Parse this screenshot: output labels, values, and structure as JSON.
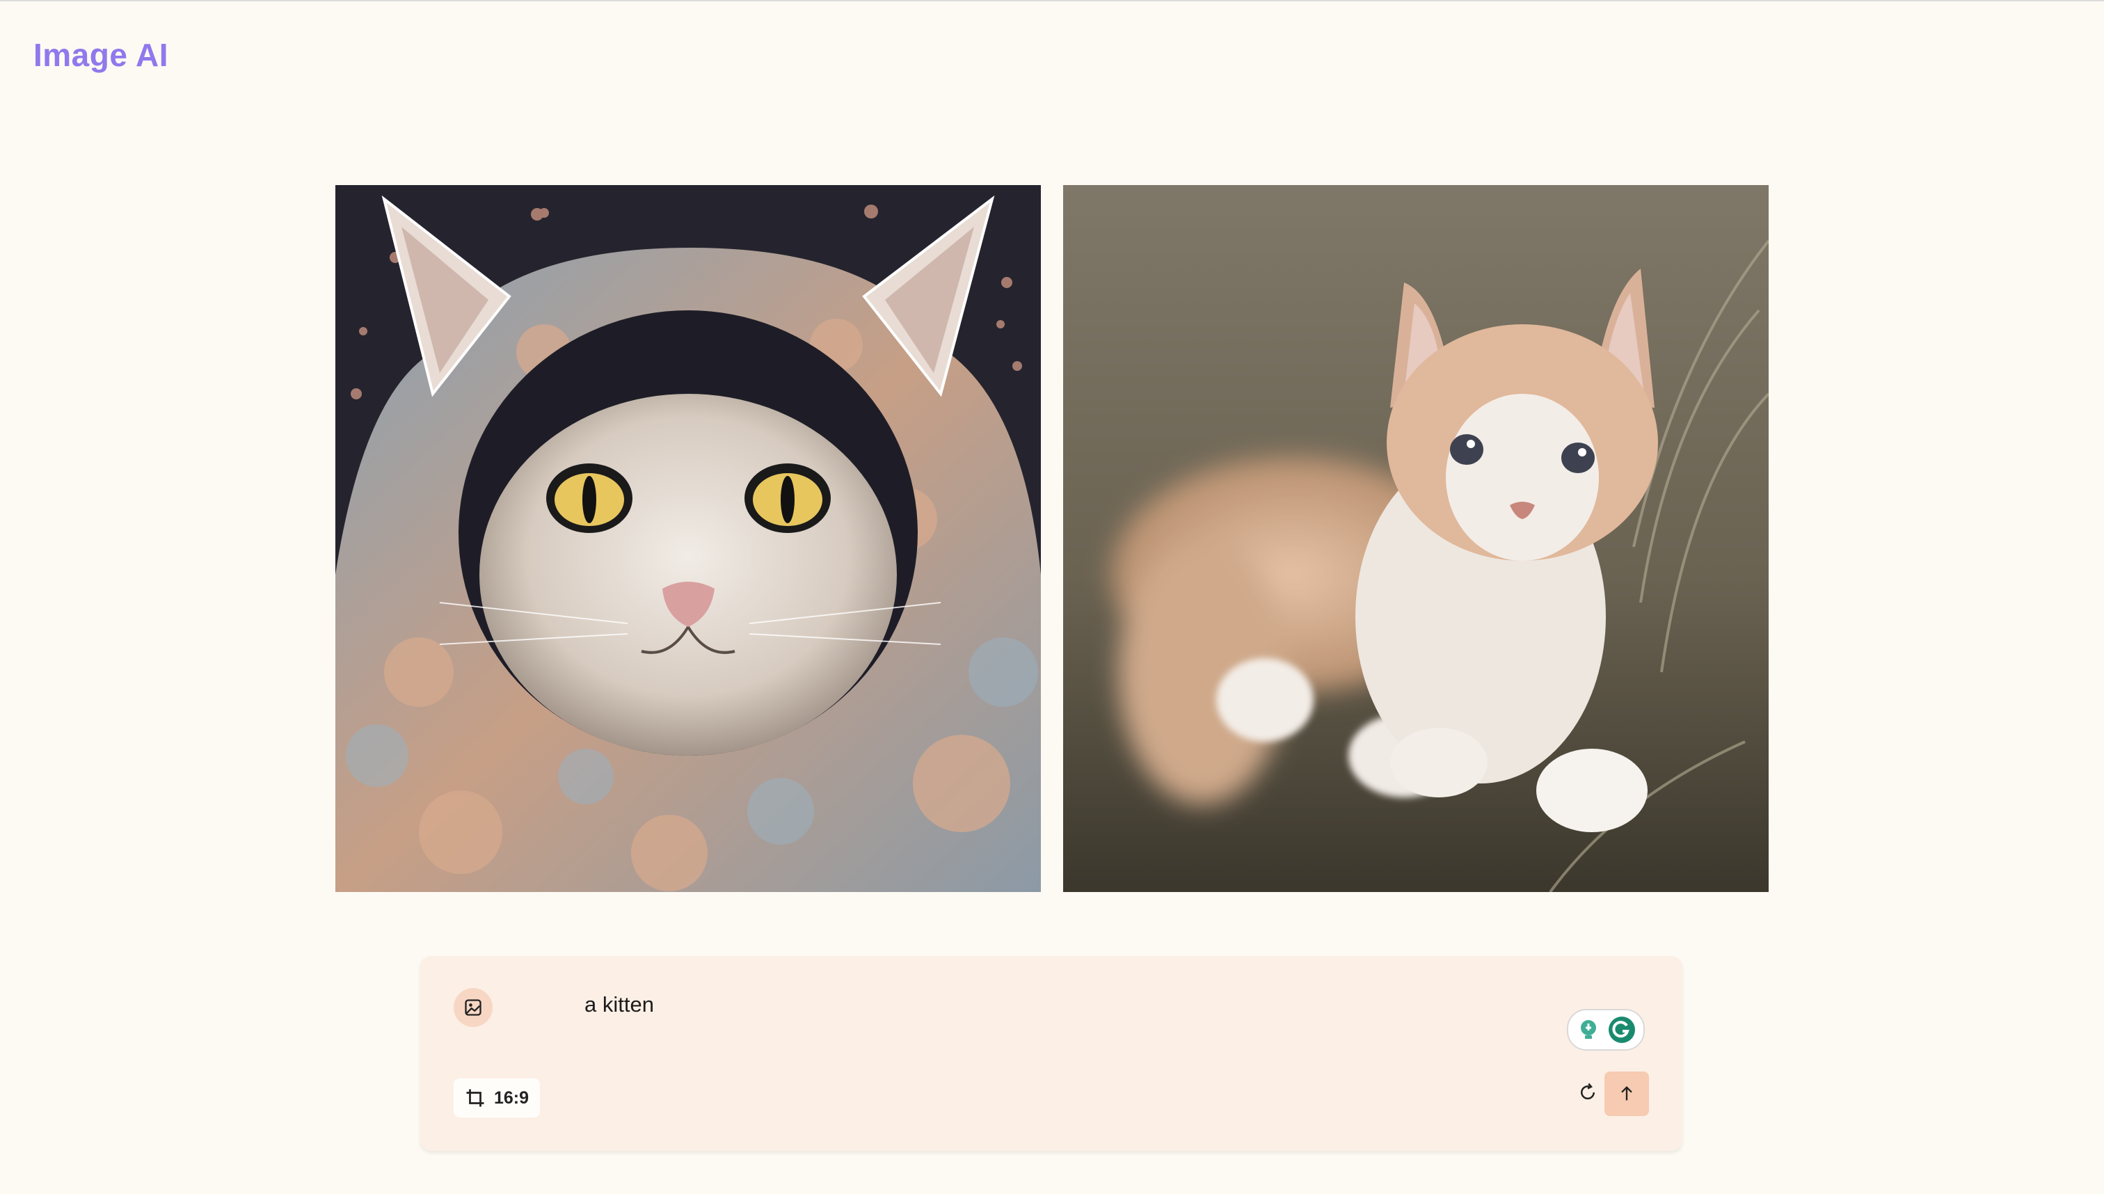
{
  "app": {
    "title": "Image AI",
    "accent_color": "#8f79ec"
  },
  "gallery": {
    "images": [
      {
        "subject": "illustrated cat wrapped in floral hooded scarf"
      },
      {
        "subject": "photo of orange and white kitten in grass"
      }
    ]
  },
  "composer": {
    "image_button_icon": "image-icon",
    "prompt_value": "a kitten",
    "aspect_ratio_label": "16:9",
    "aspect_icon": "crop-icon",
    "reset_icon": "refresh-icon",
    "send_icon": "arrow-up-icon",
    "assist_icons": [
      "lightbulb-icon",
      "grammarly-icon"
    ],
    "background_color": "#fcefe5",
    "send_color": "#f6cbb1"
  }
}
